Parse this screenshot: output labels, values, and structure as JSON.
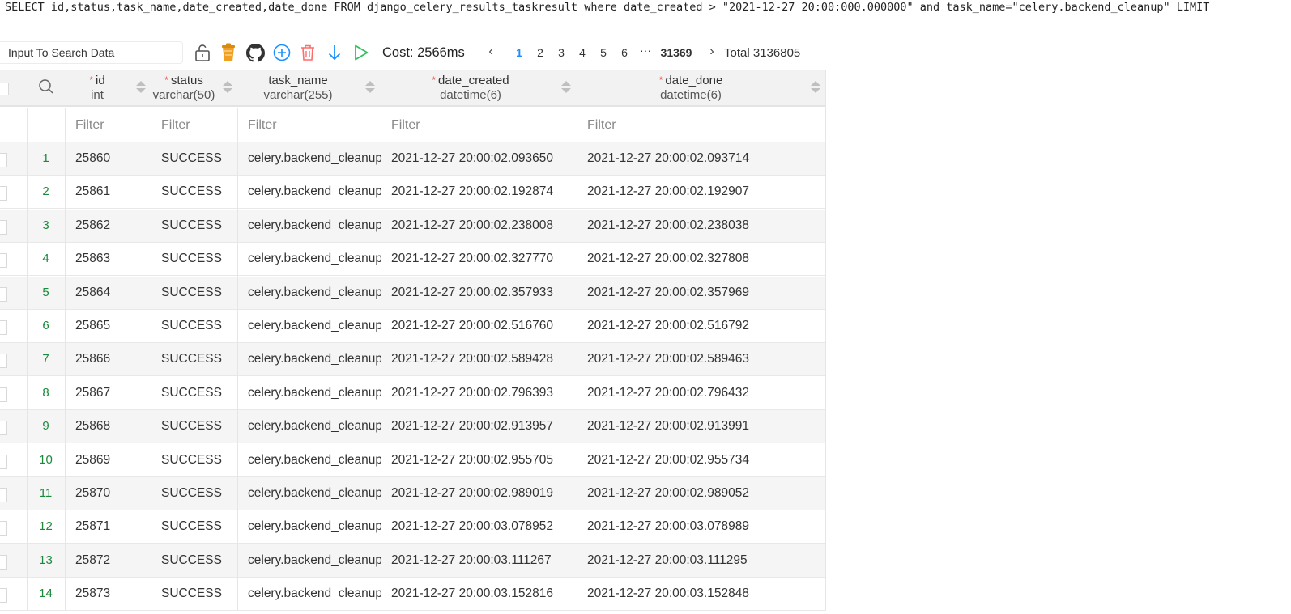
{
  "sql": "SELECT id,status,task_name,date_created,date_done FROM django_celery_results_taskresult where date_created > \"2021-12-27 20:00:000.000000\" and task_name=\"celery.backend_cleanup\" LIMIT",
  "toolbar": {
    "search_placeholder": "Input To Search Data",
    "cost": "Cost: 2566ms",
    "icons": [
      "lock-open-icon",
      "bucket-icon",
      "github-icon",
      "add-circle-icon",
      "delete-icon",
      "arrow-down-icon",
      "play-icon"
    ],
    "colors": {
      "bucket": "#f0a020",
      "add": "#1890ff",
      "delete": "#ff6b6b",
      "arrow": "#1890ff",
      "play": "#2fc25b"
    }
  },
  "pagination": {
    "pages": [
      "1",
      "2",
      "3",
      "4",
      "5",
      "6"
    ],
    "ellipsis": "···",
    "last_page": "31369",
    "current": "1",
    "total": "Total 3136805"
  },
  "columns": [
    {
      "name": "id",
      "type": "int",
      "required": true
    },
    {
      "name": "status",
      "type": "varchar(50)",
      "required": true
    },
    {
      "name": "task_name",
      "type": "varchar(255)",
      "required": false
    },
    {
      "name": "date_created",
      "type": "datetime(6)",
      "required": true
    },
    {
      "name": "date_done",
      "type": "datetime(6)",
      "required": true
    }
  ],
  "filter_placeholder": "Filter",
  "rows": [
    {
      "n": "1",
      "id": "25860",
      "status": "SUCCESS",
      "task_name": "celery.backend_cleanup",
      "date_created": "2021-12-27 20:00:02.093650",
      "date_done": "2021-12-27 20:00:02.093714"
    },
    {
      "n": "2",
      "id": "25861",
      "status": "SUCCESS",
      "task_name": "celery.backend_cleanup",
      "date_created": "2021-12-27 20:00:02.192874",
      "date_done": "2021-12-27 20:00:02.192907"
    },
    {
      "n": "3",
      "id": "25862",
      "status": "SUCCESS",
      "task_name": "celery.backend_cleanup",
      "date_created": "2021-12-27 20:00:02.238008",
      "date_done": "2021-12-27 20:00:02.238038"
    },
    {
      "n": "4",
      "id": "25863",
      "status": "SUCCESS",
      "task_name": "celery.backend_cleanup",
      "date_created": "2021-12-27 20:00:02.327770",
      "date_done": "2021-12-27 20:00:02.327808"
    },
    {
      "n": "5",
      "id": "25864",
      "status": "SUCCESS",
      "task_name": "celery.backend_cleanup",
      "date_created": "2021-12-27 20:00:02.357933",
      "date_done": "2021-12-27 20:00:02.357969"
    },
    {
      "n": "6",
      "id": "25865",
      "status": "SUCCESS",
      "task_name": "celery.backend_cleanup",
      "date_created": "2021-12-27 20:00:02.516760",
      "date_done": "2021-12-27 20:00:02.516792"
    },
    {
      "n": "7",
      "id": "25866",
      "status": "SUCCESS",
      "task_name": "celery.backend_cleanup",
      "date_created": "2021-12-27 20:00:02.589428",
      "date_done": "2021-12-27 20:00:02.589463"
    },
    {
      "n": "8",
      "id": "25867",
      "status": "SUCCESS",
      "task_name": "celery.backend_cleanup",
      "date_created": "2021-12-27 20:00:02.796393",
      "date_done": "2021-12-27 20:00:02.796432"
    },
    {
      "n": "9",
      "id": "25868",
      "status": "SUCCESS",
      "task_name": "celery.backend_cleanup",
      "date_created": "2021-12-27 20:00:02.913957",
      "date_done": "2021-12-27 20:00:02.913991"
    },
    {
      "n": "10",
      "id": "25869",
      "status": "SUCCESS",
      "task_name": "celery.backend_cleanup",
      "date_created": "2021-12-27 20:00:02.955705",
      "date_done": "2021-12-27 20:00:02.955734"
    },
    {
      "n": "11",
      "id": "25870",
      "status": "SUCCESS",
      "task_name": "celery.backend_cleanup",
      "date_created": "2021-12-27 20:00:02.989019",
      "date_done": "2021-12-27 20:00:02.989052"
    },
    {
      "n": "12",
      "id": "25871",
      "status": "SUCCESS",
      "task_name": "celery.backend_cleanup",
      "date_created": "2021-12-27 20:00:03.078952",
      "date_done": "2021-12-27 20:00:03.078989"
    },
    {
      "n": "13",
      "id": "25872",
      "status": "SUCCESS",
      "task_name": "celery.backend_cleanup",
      "date_created": "2021-12-27 20:00:03.111267",
      "date_done": "2021-12-27 20:00:03.111295"
    },
    {
      "n": "14",
      "id": "25873",
      "status": "SUCCESS",
      "task_name": "celery.backend_cleanup",
      "date_created": "2021-12-27 20:00:03.152816",
      "date_done": "2021-12-27 20:00:03.152848"
    }
  ]
}
